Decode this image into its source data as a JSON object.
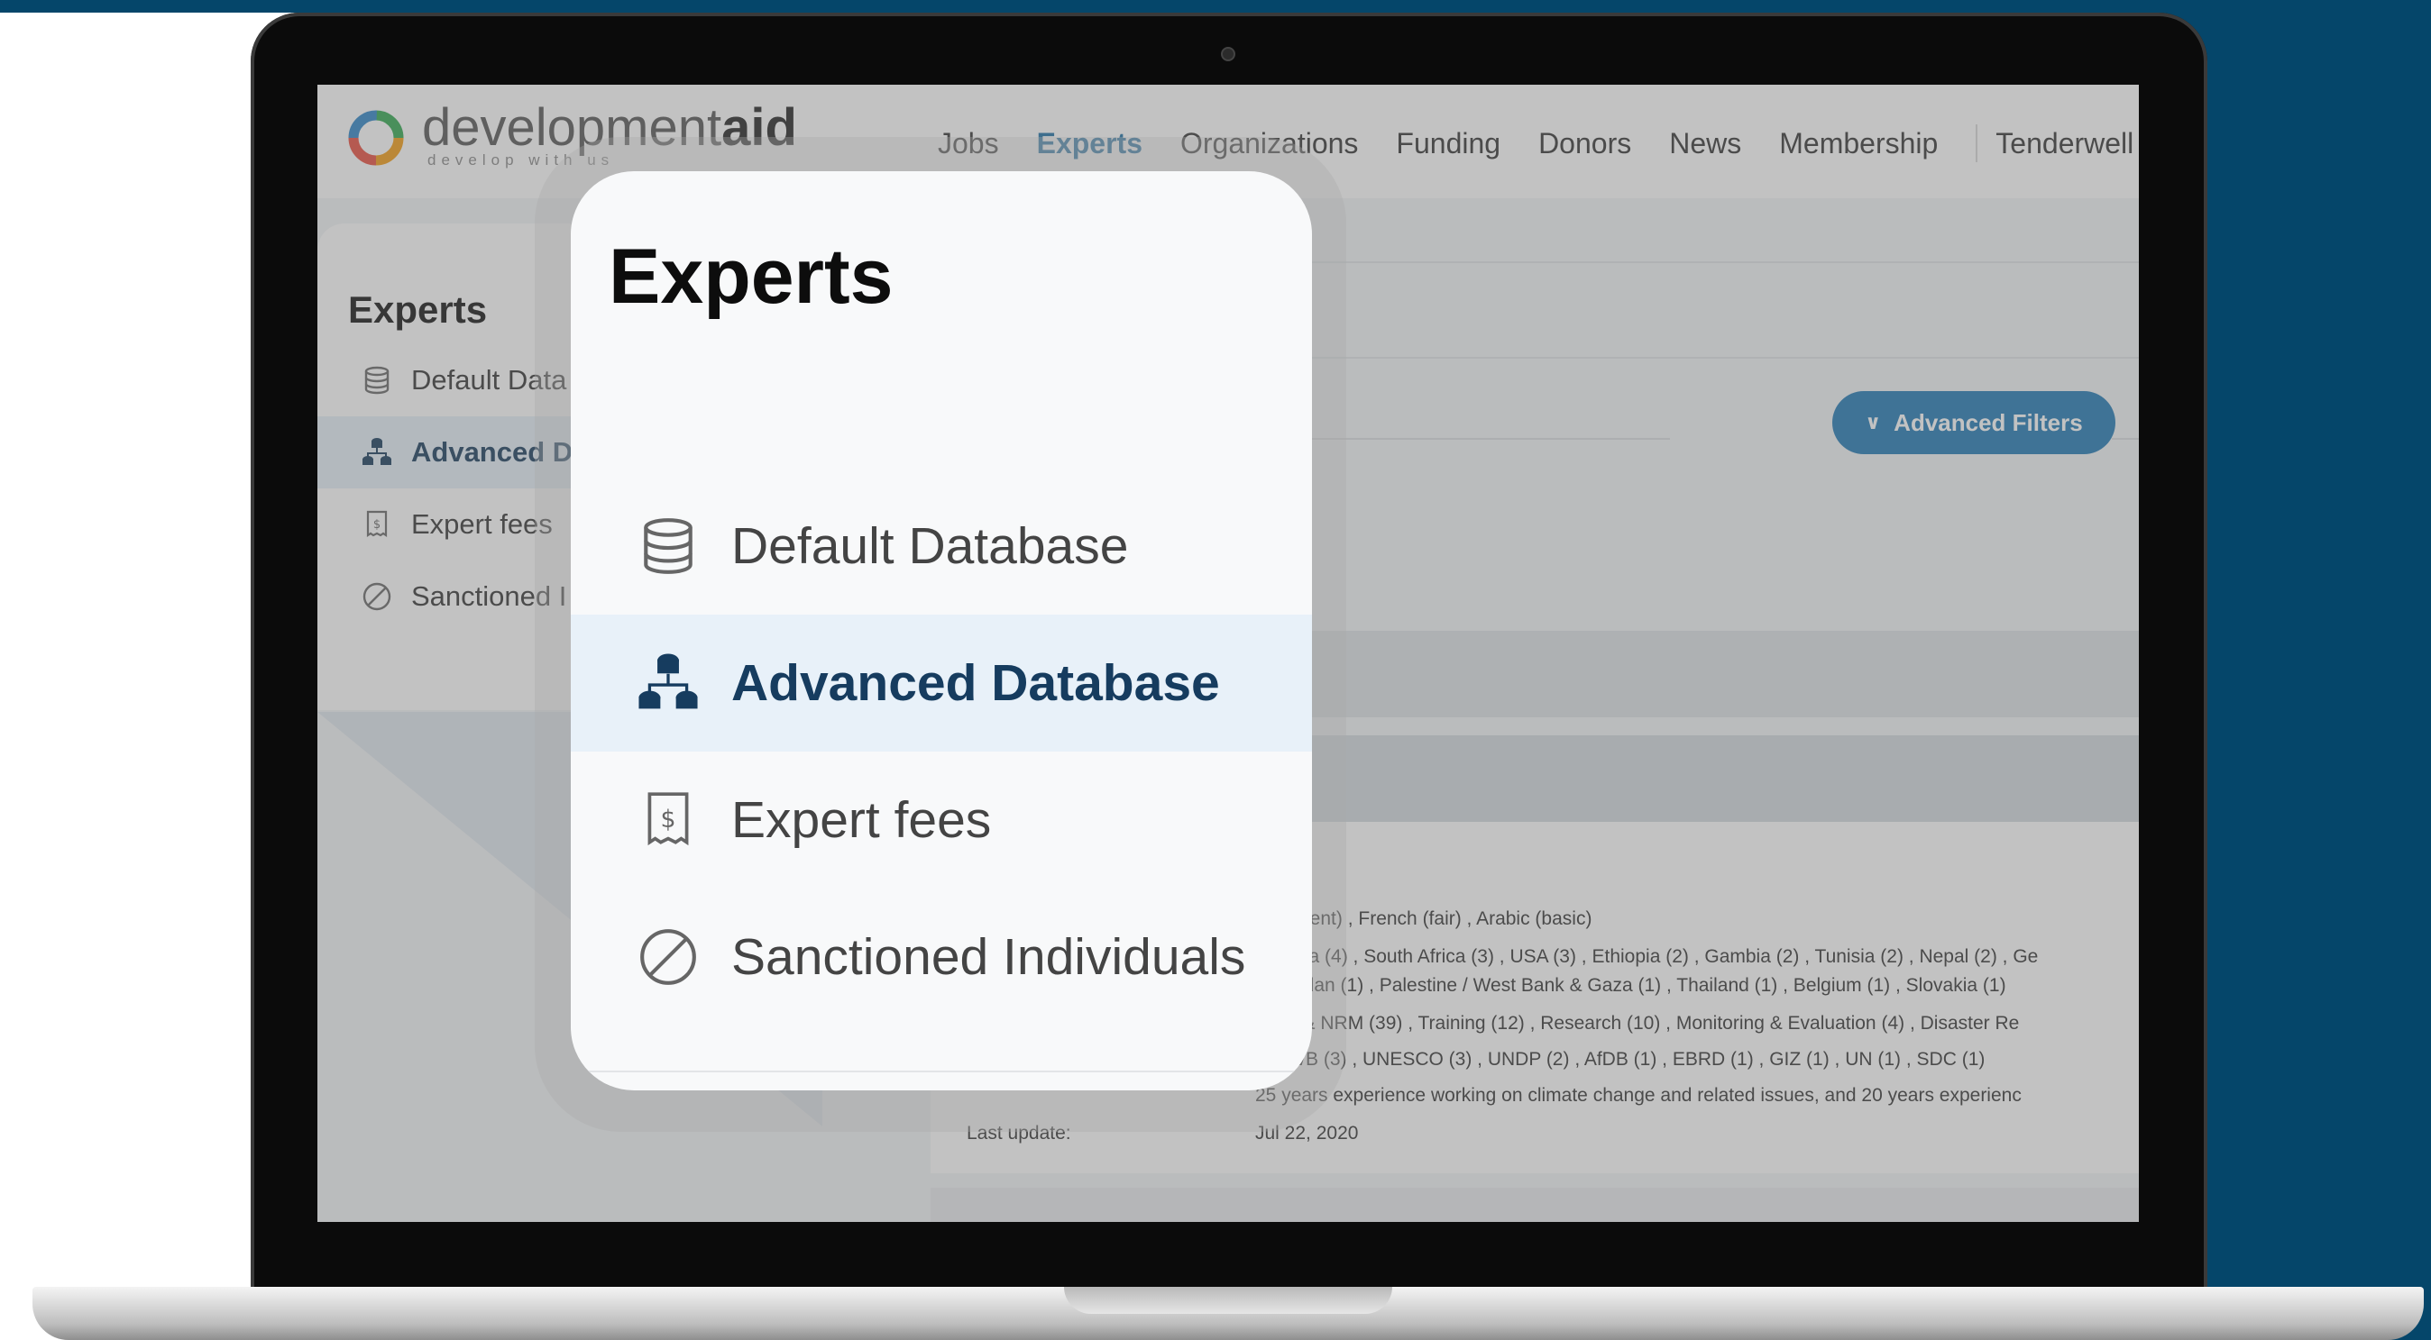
{
  "site": {
    "logo_text_light": "development",
    "logo_text_bold": "aid",
    "tagline": "develop with us",
    "colors": {
      "brand_blue": "#1c6ea4",
      "navy_background": "#05466a",
      "button_blue": "#1e77b3",
      "selected_bg": "#e6f0f8"
    }
  },
  "nav": {
    "items": [
      {
        "label": "Jobs"
      },
      {
        "label": "Experts",
        "active": true
      },
      {
        "label": "Organizations"
      },
      {
        "label": "Funding"
      },
      {
        "label": "Donors"
      },
      {
        "label": "News"
      },
      {
        "label": "Membership"
      },
      {
        "label": "Tenderwell"
      }
    ]
  },
  "sidebar": {
    "title": "Experts",
    "items": [
      {
        "label": "Default Data",
        "icon": "database-icon"
      },
      {
        "label": "Advanced D",
        "icon": "hierarchy-database-icon",
        "selected": true
      },
      {
        "label": "Expert fees",
        "icon": "receipt-dollar-icon"
      },
      {
        "label": "Sanctioned I",
        "icon": "ban-icon"
      }
    ]
  },
  "content": {
    "advanced_filters_label": "Advanced Filters",
    "detail_rows": [
      "(excellent) , French (fair) , Arabic (basic)",
      ", Kenya (4) , South Africa (3) , USA (3) , Ethiopia (2) , Gambia (2) , Tunisia (2) , Nepal (2) , Ge",
      ") , Jordan (1) , Palestine / West Bank & Gaza (1) , Thailand (1) , Belgium (1) , Slovakia (1)",
      "ment & NRM (39) , Training (12) , Research (10) , Monitoring & Evaluation (4) , Disaster Re",
      "1) , WB (3) , UNESCO (3) , UNDP (2) , AfDB (1) , EBRD (1) , GIZ (1) , UN (1) , SDC (1)",
      "25 years experience working on climate change and related issues, and 20 years experienc"
    ],
    "last_update_label": "Last update:",
    "last_update_value": "Jul 22, 2020"
  },
  "popup": {
    "title": "Experts",
    "items": [
      {
        "label": "Default Database",
        "icon": "database-icon"
      },
      {
        "label": "Advanced Database",
        "icon": "hierarchy-database-icon",
        "selected": true
      },
      {
        "label": "Expert fees",
        "icon": "receipt-dollar-icon"
      },
      {
        "label": "Sanctioned Individuals",
        "icon": "ban-icon"
      }
    ]
  }
}
